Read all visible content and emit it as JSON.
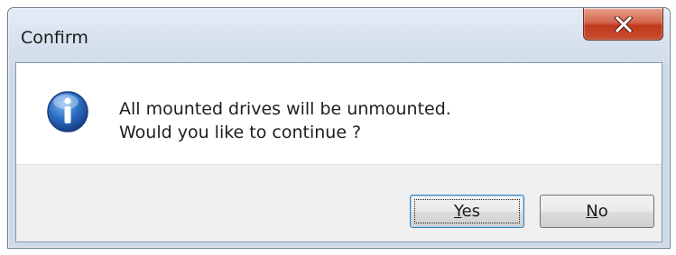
{
  "dialog": {
    "title": "Confirm",
    "icon": "info-icon",
    "message_line1": "All mounted drives will be unmounted.",
    "message_line2": "Would you like to continue ?",
    "buttons": {
      "yes": {
        "mnemonic": "Y",
        "rest": "es"
      },
      "no": {
        "mnemonic": "N",
        "rest": "o"
      }
    },
    "close_icon": "close-icon",
    "colors": {
      "close_button": "#c84f32",
      "info_icon": "#2a6fc4",
      "default_button_border": "#3c7fb1"
    }
  }
}
